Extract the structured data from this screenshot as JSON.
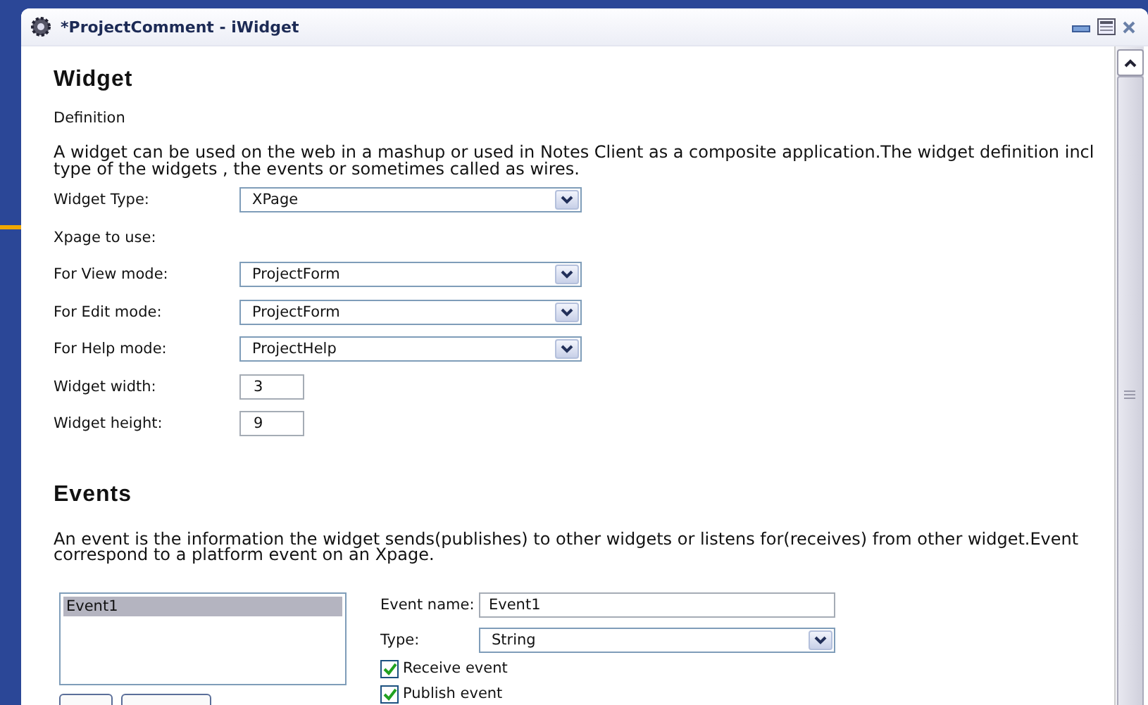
{
  "window": {
    "title": "*ProjectComment - iWidget"
  },
  "widget": {
    "heading": "Widget",
    "subheading": "Definition",
    "description_lines": [
      "A widget can be used on the web in a mashup or used in Notes Client as a composite application.The widget definition incl",
      " type of the widgets , the events or sometimes called as wires."
    ],
    "fields": [
      {
        "kind": "dropdown",
        "label": "Widget Type:",
        "value": "XPage"
      },
      {
        "kind": "label",
        "label": "Xpage to use:"
      },
      {
        "kind": "dropdown",
        "label": "For View mode:",
        "value": "ProjectForm"
      },
      {
        "kind": "dropdown",
        "label": "For Edit mode:",
        "value": "ProjectForm"
      },
      {
        "kind": "dropdown",
        "label": "For Help mode:",
        "value": "ProjectHelp"
      },
      {
        "kind": "number",
        "label": "Widget width:",
        "value": "3"
      },
      {
        "kind": "number",
        "label": "Widget height:",
        "value": "9"
      }
    ]
  },
  "events": {
    "heading": "Events",
    "description_lines": [
      "An event is the information the widget sends(publishes) to other widgets or listens for(receives) from other widget.Event",
      " correspond to a platform event on an Xpage."
    ],
    "list": [
      {
        "label": "Event1",
        "selected": true
      }
    ],
    "event_name": {
      "label": "Event name:",
      "value": "Event1"
    },
    "type": {
      "label": "Type:",
      "value": "String"
    },
    "checkboxes": [
      {
        "label": "Receive event",
        "checked": true
      },
      {
        "label": "Publish event",
        "checked": true
      }
    ]
  }
}
